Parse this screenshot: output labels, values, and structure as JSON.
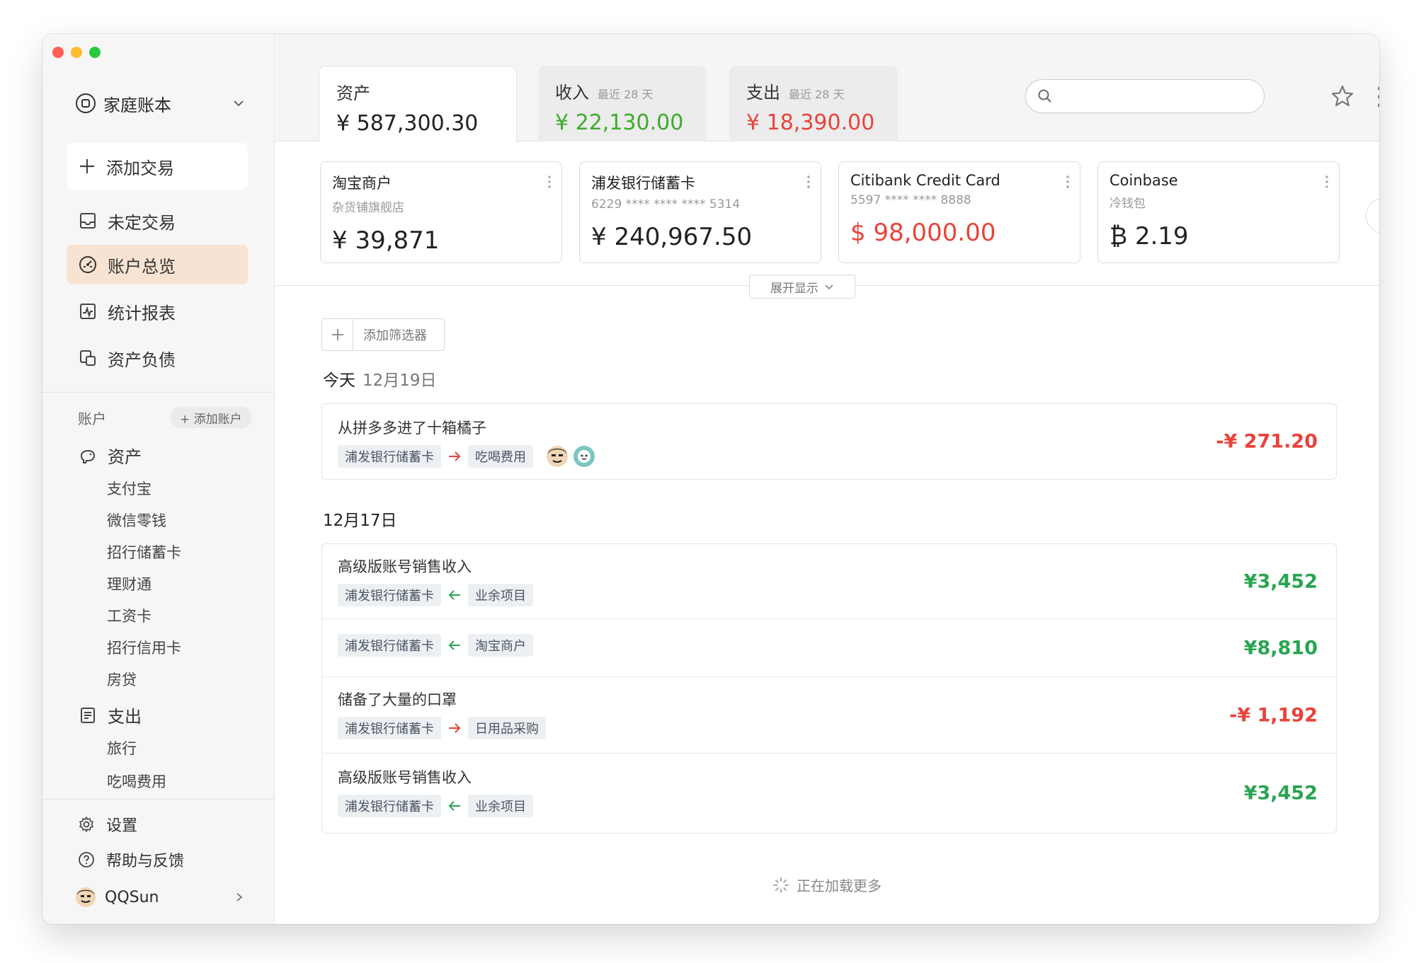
{
  "sidebar": {
    "book_name": "家庭账本",
    "add_transaction": "添加交易",
    "nav": [
      {
        "label": "未定交易",
        "icon": "inbox-icon"
      },
      {
        "label": "账户总览",
        "icon": "dashboard-icon",
        "active": true
      },
      {
        "label": "统计报表",
        "icon": "chart-icon"
      },
      {
        "label": "资产负债",
        "icon": "balance-sheet-icon"
      }
    ],
    "accounts_label": "账户",
    "add_account": "+ 添加账户",
    "groups": [
      {
        "label": "资产",
        "icon": "piggy-bank-icon",
        "items": [
          "支付宝",
          "微信零钱",
          "招行储蓄卡",
          "理财通",
          "工资卡",
          "招行信用卡",
          "房贷"
        ]
      },
      {
        "label": "支出",
        "icon": "receipt-icon",
        "items": [
          "旅行",
          "吃喝费用"
        ]
      }
    ],
    "settings": "设置",
    "help": "帮助与反馈",
    "user": "QQSun"
  },
  "tabs": [
    {
      "title": "资产",
      "subtitle": "",
      "amount": "¥ 587,300.30"
    },
    {
      "title": "收入",
      "subtitle": "最近 28 天",
      "amount": "¥ 22,130.00"
    },
    {
      "title": "支出",
      "subtitle": "最近 28 天",
      "amount": "¥ 18,390.00"
    }
  ],
  "search": {
    "placeholder": ""
  },
  "cards": [
    {
      "name": "淘宝商户",
      "sub": "杂货铺旗舰店",
      "amount": "¥ 39,871"
    },
    {
      "name": "浦发银行储蓄卡",
      "sub": "6229 **** **** **** 5314",
      "amount": "¥ 240,967.50"
    },
    {
      "name": "Citibank Credit Card",
      "sub": "5597 **** **** 8888",
      "amount": "$ 98,000.00"
    },
    {
      "name": "Coinbase",
      "sub": "冷钱包",
      "amount": "₿ 2.19"
    }
  ],
  "expand": "展开显示",
  "filter": "添加筛选器",
  "days": [
    {
      "label": "今天",
      "date": "12月19日",
      "transactions": [
        {
          "title": "从拼多多进了十箱橘子",
          "from": "浦发银行储蓄卡",
          "direction": "out",
          "to": "吃喝费用",
          "amount": "-¥ 271.20"
        }
      ]
    },
    {
      "label": "12月17日",
      "date": "",
      "transactions": [
        {
          "title": "高级版账号销售收入",
          "from": "浦发银行储蓄卡",
          "direction": "in",
          "to": "业余项目",
          "amount": "¥3,452"
        },
        {
          "title": "",
          "from": "浦发银行储蓄卡",
          "direction": "in",
          "to": "淘宝商户",
          "amount": "¥8,810"
        },
        {
          "title": "储备了大量的口罩",
          "from": "浦发银行储蓄卡",
          "direction": "out",
          "to": "日用品采购",
          "amount": "-¥ 1,192"
        },
        {
          "title": "高级版账号销售收入",
          "from": "浦发银行储蓄卡",
          "direction": "in",
          "to": "业余项目",
          "amount": "¥3,452"
        }
      ]
    }
  ],
  "loading": "正在加载更多",
  "colors": {
    "income": "#2aa451",
    "expense": "#e8433a",
    "active_nav": "#f8e3d2",
    "income_tab": "#3dab2c"
  }
}
